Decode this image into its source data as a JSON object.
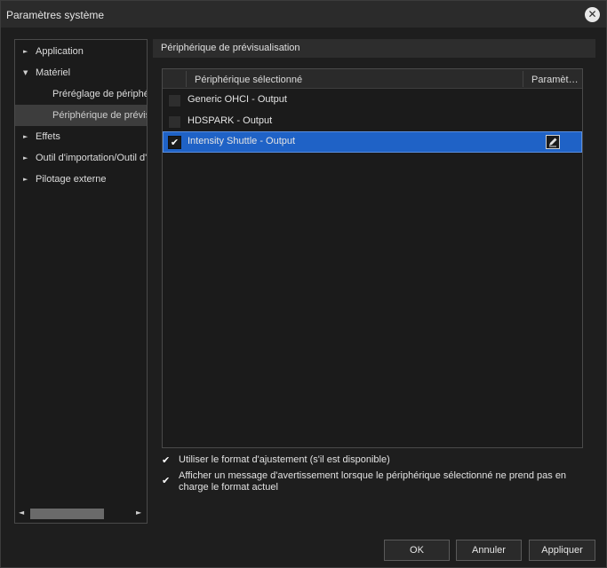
{
  "window": {
    "title": "Paramètres système",
    "close_glyph": "✕"
  },
  "sidebar": {
    "items": [
      {
        "label": "Application",
        "expander": "►"
      },
      {
        "label": "Matériel",
        "expander": "▼"
      },
      {
        "label": "Préréglage de périphé",
        "expander": ""
      },
      {
        "label": "Périphérique de prévis",
        "expander": ""
      },
      {
        "label": "Effets",
        "expander": "►"
      },
      {
        "label": "Outil d'importation/Outil d'",
        "expander": "►"
      },
      {
        "label": "Pilotage externe",
        "expander": "►"
      }
    ],
    "scroll_left": "◄",
    "scroll_right": "►"
  },
  "section": {
    "title": "Périphérique de prévisualisation"
  },
  "table": {
    "columns": [
      "Périphérique sélectionné",
      "Paramèt…"
    ],
    "rows": [
      {
        "label": "Generic OHCI - Output",
        "checked": false,
        "check": ""
      },
      {
        "label": "HDSPARK - Output",
        "checked": false,
        "check": ""
      },
      {
        "label": "Intensity Shuttle - Output",
        "checked": true,
        "check": "✔"
      }
    ],
    "edit_icon": "edit-settings-icon"
  },
  "options": [
    {
      "label": "Utiliser le format d'ajustement (s'il est disponible)",
      "checked": true,
      "check": "✔"
    },
    {
      "label": "Afficher un message d'avertissement lorsque le périphérique sélectionné ne prend pas en charge le format actuel",
      "checked": true,
      "check": "✔"
    }
  ],
  "buttons": {
    "ok": "OK",
    "cancel": "Annuler",
    "apply": "Appliquer"
  },
  "colors": {
    "background": "#1e1e1e",
    "selection": "#1f62c6",
    "panel_header": "#2d2d2d"
  }
}
